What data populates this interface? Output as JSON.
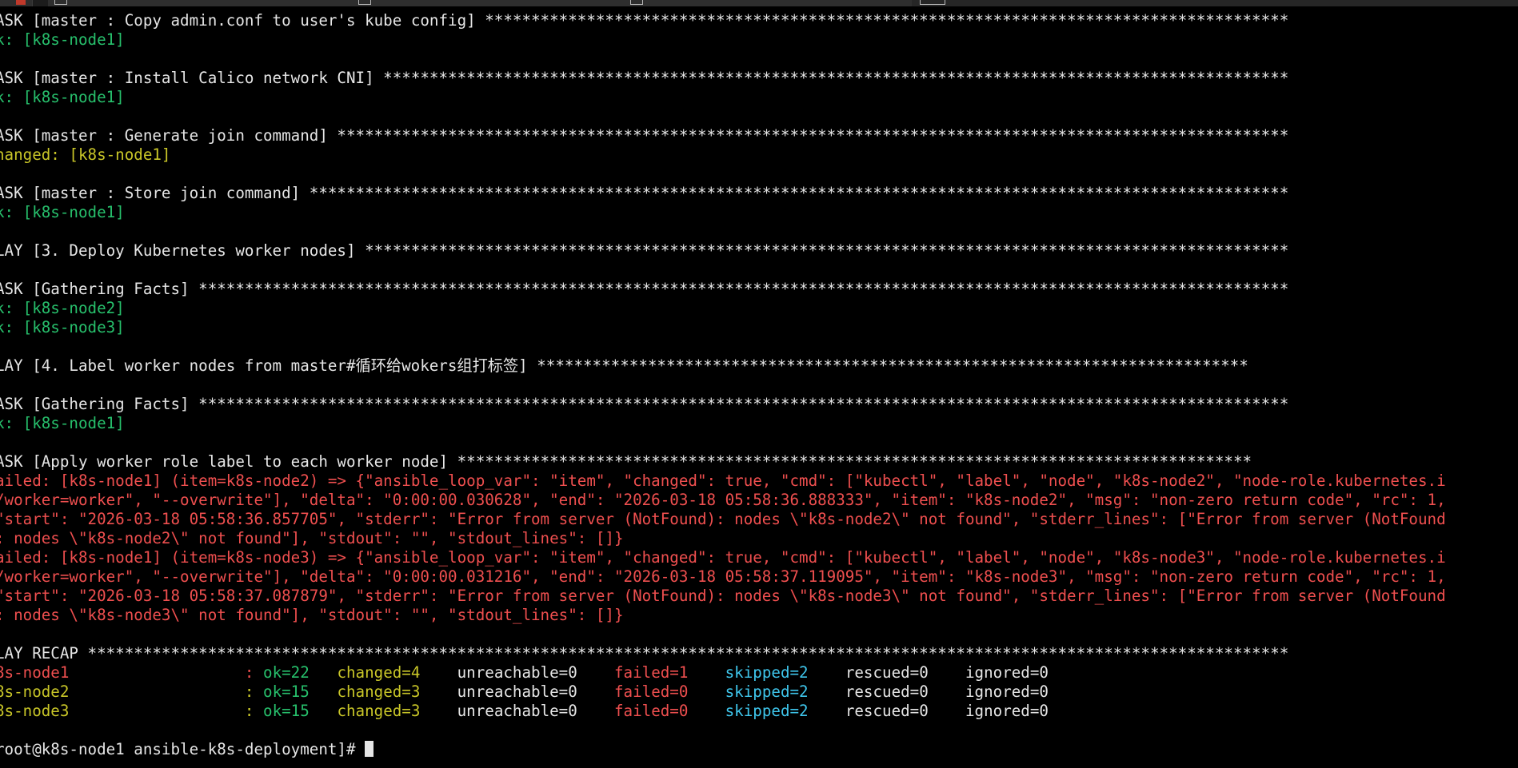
{
  "window": {
    "accent_colors": {
      "background": "#000000",
      "ok": "#27c06c",
      "changed": "#c9c628",
      "failed": "#ef4f4f",
      "skipped": "#3fc6ec",
      "text": "#e6e6e6"
    }
  },
  "terminal": {
    "lines": [
      {
        "segs": [
          {
            "t": "ASK [master : Copy admin.conf to user's kube config] ***************************************************************************************",
            "c": "white"
          }
        ]
      },
      {
        "segs": [
          {
            "t": "k: [k8s-node1]",
            "c": "green"
          }
        ]
      },
      {
        "segs": []
      },
      {
        "segs": [
          {
            "t": "ASK [master : Install Calico network CNI] **************************************************************************************************",
            "c": "white"
          }
        ]
      },
      {
        "segs": [
          {
            "t": "k: [k8s-node1]",
            "c": "green"
          }
        ]
      },
      {
        "segs": []
      },
      {
        "segs": [
          {
            "t": "ASK [master : Generate join command] *******************************************************************************************************",
            "c": "white"
          }
        ]
      },
      {
        "segs": [
          {
            "t": "hanged: [k8s-node1]",
            "c": "yellow"
          }
        ]
      },
      {
        "segs": []
      },
      {
        "segs": [
          {
            "t": "ASK [master : Store join command] **********************************************************************************************************",
            "c": "white"
          }
        ]
      },
      {
        "segs": [
          {
            "t": "k: [k8s-node1]",
            "c": "green"
          }
        ]
      },
      {
        "segs": []
      },
      {
        "segs": [
          {
            "t": "LAY [3. Deploy Kubernetes worker nodes] ****************************************************************************************************",
            "c": "white"
          }
        ]
      },
      {
        "segs": []
      },
      {
        "segs": [
          {
            "t": "ASK [Gathering Facts] **********************************************************************************************************************",
            "c": "white"
          }
        ]
      },
      {
        "segs": [
          {
            "t": "k: [k8s-node2]",
            "c": "green"
          }
        ]
      },
      {
        "segs": [
          {
            "t": "k: [k8s-node3]",
            "c": "green"
          }
        ]
      },
      {
        "segs": []
      },
      {
        "segs": [
          {
            "t": "LAY [4. Label worker nodes from master#循环给wokers组打标签] *****************************************************************************",
            "c": "white"
          }
        ]
      },
      {
        "segs": []
      },
      {
        "segs": [
          {
            "t": "ASK [Gathering Facts] **********************************************************************************************************************",
            "c": "white"
          }
        ]
      },
      {
        "segs": [
          {
            "t": "k: [k8s-node1]",
            "c": "green"
          }
        ]
      },
      {
        "segs": []
      },
      {
        "segs": [
          {
            "t": "ASK [Apply worker role label to each worker node] **************************************************************************************",
            "c": "white"
          }
        ]
      },
      {
        "segs": [
          {
            "t": "ailed: [k8s-node1] (item=k8s-node2) => {\"ansible_loop_var\": \"item\", \"changed\": true, \"cmd\": [\"kubectl\", \"label\", \"node\", \"k8s-node2\", \"node-role.kubernetes.i",
            "c": "red"
          }
        ]
      },
      {
        "segs": [
          {
            "t": "/worker=worker\", \"--overwrite\"], \"delta\": \"0:00:00.030628\", \"end\": \"2026-03-18 05:58:36.888333\", \"item\": \"k8s-node2\", \"msg\": \"non-zero return code\", \"rc\": 1,",
            "c": "red"
          }
        ]
      },
      {
        "segs": [
          {
            "t": "\"start\": \"2026-03-18 05:58:36.857705\", \"stderr\": \"Error from server (NotFound): nodes \\\"k8s-node2\\\" not found\", \"stderr_lines\": [\"Error from server (NotFound",
            "c": "red"
          }
        ]
      },
      {
        "segs": [
          {
            "t": ": nodes \\\"k8s-node2\\\" not found\"], \"stdout\": \"\", \"stdout_lines\": []}",
            "c": "red"
          }
        ]
      },
      {
        "segs": [
          {
            "t": "ailed: [k8s-node1] (item=k8s-node3) => {\"ansible_loop_var\": \"item\", \"changed\": true, \"cmd\": [\"kubectl\", \"label\", \"node\", \"k8s-node3\", \"node-role.kubernetes.i",
            "c": "red"
          }
        ]
      },
      {
        "segs": [
          {
            "t": "/worker=worker\", \"--overwrite\"], \"delta\": \"0:00:00.031216\", \"end\": \"2026-03-18 05:58:37.119095\", \"item\": \"k8s-node3\", \"msg\": \"non-zero return code\", \"rc\": 1,",
            "c": "red"
          }
        ]
      },
      {
        "segs": [
          {
            "t": "\"start\": \"2026-03-18 05:58:37.087879\", \"stderr\": \"Error from server (NotFound): nodes \\\"k8s-node3\\\" not found\", \"stderr_lines\": [\"Error from server (NotFound",
            "c": "red"
          }
        ]
      },
      {
        "segs": [
          {
            "t": ": nodes \\\"k8s-node3\\\" not found\"], \"stdout\": \"\", \"stdout_lines\": []}",
            "c": "red"
          }
        ]
      },
      {
        "segs": []
      },
      {
        "segs": [
          {
            "t": "LAY RECAP **********************************************************************************************************************************",
            "c": "white"
          }
        ]
      },
      {
        "segs": [
          {
            "t": "8s-node1                   : ",
            "c": "red"
          },
          {
            "t": "ok=22   ",
            "c": "green"
          },
          {
            "t": "changed=4   ",
            "c": "yellow"
          },
          {
            "t": " unreachable=0    ",
            "c": "white"
          },
          {
            "t": "failed=1   ",
            "c": "red"
          },
          {
            "t": " skipped=2   ",
            "c": "cyan"
          },
          {
            "t": " rescued=0    ignored=0",
            "c": "white"
          }
        ]
      },
      {
        "segs": [
          {
            "t": "8s-node2                   : ",
            "c": "yellow"
          },
          {
            "t": "ok=15   ",
            "c": "green"
          },
          {
            "t": "changed=3   ",
            "c": "yellow"
          },
          {
            "t": " unreachable=0    ",
            "c": "white"
          },
          {
            "t": "failed=0   ",
            "c": "red"
          },
          {
            "t": " skipped=2   ",
            "c": "cyan"
          },
          {
            "t": " rescued=0    ignored=0",
            "c": "white"
          }
        ]
      },
      {
        "segs": [
          {
            "t": "8s-node3                   : ",
            "c": "yellow"
          },
          {
            "t": "ok=15   ",
            "c": "green"
          },
          {
            "t": "changed=3   ",
            "c": "yellow"
          },
          {
            "t": " unreachable=0    ",
            "c": "white"
          },
          {
            "t": "failed=0   ",
            "c": "red"
          },
          {
            "t": " skipped=2   ",
            "c": "cyan"
          },
          {
            "t": " rescued=0    ignored=0",
            "c": "white"
          }
        ]
      },
      {
        "segs": []
      },
      {
        "segs": [
          {
            "t": "root@k8s-node1 ansible-k8s-deployment]# ",
            "c": "white"
          }
        ],
        "cursor": true
      }
    ]
  }
}
